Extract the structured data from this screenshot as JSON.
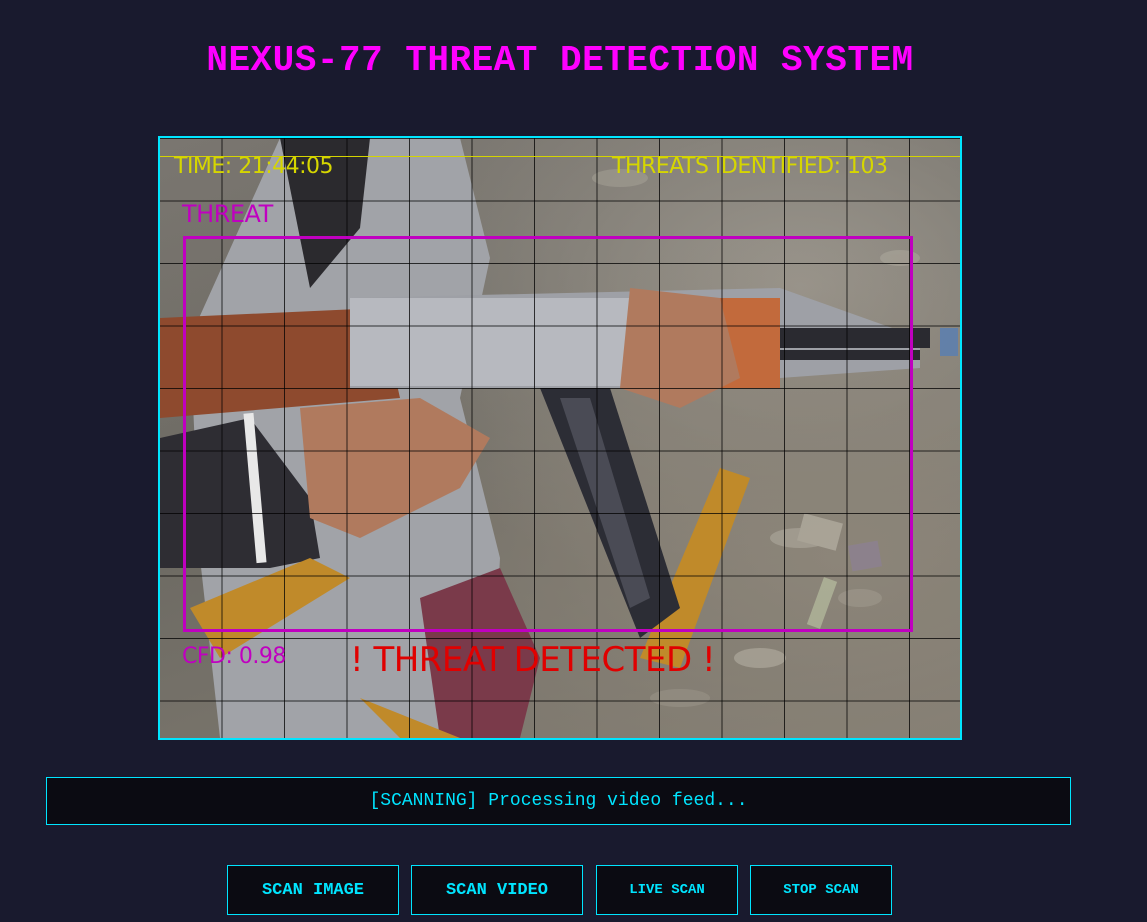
{
  "header": {
    "title": "NEXUS-77 THREAT DETECTION SYSTEM"
  },
  "feed": {
    "time_text": "TIME: 21:44:05",
    "threat_count_text": "THREATS IDENTIFIED: 103",
    "box_label": "THREAT",
    "confidence_text": "CFD: 0.98",
    "alert_text": "! THREAT DETECTED !"
  },
  "status": {
    "message": "[SCANNING] Processing video feed..."
  },
  "controls": {
    "scan_image": "SCAN IMAGE",
    "scan_video": "SCAN VIDEO",
    "live_scan": "LIVE SCAN",
    "stop_scan": "STOP SCAN"
  },
  "colors": {
    "background": "#191a2e",
    "accent": "#00e5ff",
    "title": "#ff00ff",
    "hud_yellow": "#d6d600",
    "hud_magenta": "#c000c0",
    "alert_red": "#e00000"
  }
}
